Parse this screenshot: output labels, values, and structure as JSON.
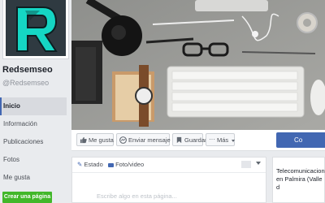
{
  "page": {
    "name": "Redsemseo",
    "handle": "@Redsemseo",
    "logo_letter": "R"
  },
  "sidebar": {
    "items": [
      {
        "label": "Inicio",
        "active": true
      },
      {
        "label": "Información"
      },
      {
        "label": "Publicaciones"
      },
      {
        "label": "Fotos"
      },
      {
        "label": "Me gusta"
      }
    ],
    "create_page": "Crear una página"
  },
  "actions": {
    "like": "Me gusta",
    "message": "Enviar mensaje",
    "save": "Guardar",
    "more": "Más",
    "primary": "Co"
  },
  "composer": {
    "tab_status": "Estado",
    "tab_photo": "Foto/video",
    "placeholder": "Escribe algo en esta página..."
  },
  "about": {
    "line1": "Telecomunicaciones",
    "line2": "en Palmira (Valle d"
  },
  "colors": {
    "brand_teal": "#15d6c4",
    "logo_bg": "#2f3a41",
    "fb_blue": "#4267b2",
    "create_green": "#42b72a"
  }
}
